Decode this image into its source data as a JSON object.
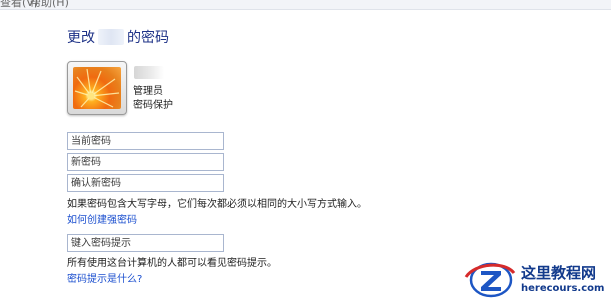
{
  "menubar": {
    "item1": "查看(V)",
    "item2": "帮助(H)"
  },
  "header": {
    "title_prefix": "更改",
    "title_suffix": "的密码"
  },
  "account": {
    "role": "管理员",
    "protection": "密码保护"
  },
  "form": {
    "current_password_placeholder": "当前密码",
    "new_password_placeholder": "新密码",
    "confirm_password_placeholder": "确认新密码",
    "case_note": "如果密码包含大写字母，它们每次都必须以相同的大小写方式输入。",
    "strong_password_link": "如何创建强密码",
    "hint_placeholder": "键入密码提示",
    "hint_note": "所有使用这台计算机的人都可以看见密码提示。",
    "hint_link": "密码提示是什么?"
  },
  "watermark": {
    "title": "这里教程网",
    "url": "herecours.com"
  }
}
